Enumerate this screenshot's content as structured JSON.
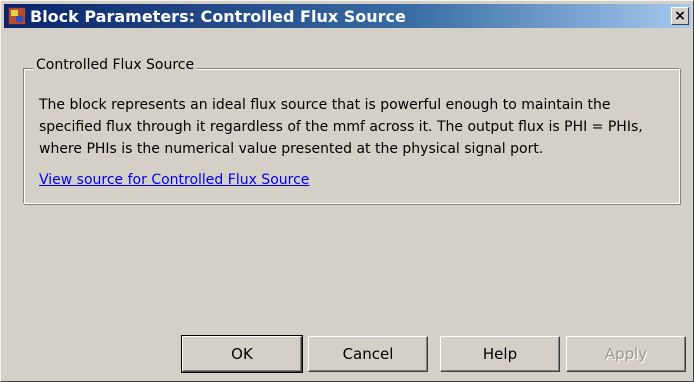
{
  "window": {
    "title": "Block Parameters: Controlled Flux Source",
    "icon": "simulink-block-icon",
    "close_label": "×"
  },
  "group": {
    "legend": "Controlled Flux Source",
    "description": "The block represents an ideal flux source that is powerful enough to maintain the specified flux through it regardless of the mmf across it. The output flux is PHI = PHIs, where PHIs is the numerical value presented at the physical signal port.",
    "link_text": "View source for Controlled Flux Source"
  },
  "buttons": {
    "ok": "OK",
    "cancel": "Cancel",
    "help": "Help",
    "apply": "Apply"
  }
}
